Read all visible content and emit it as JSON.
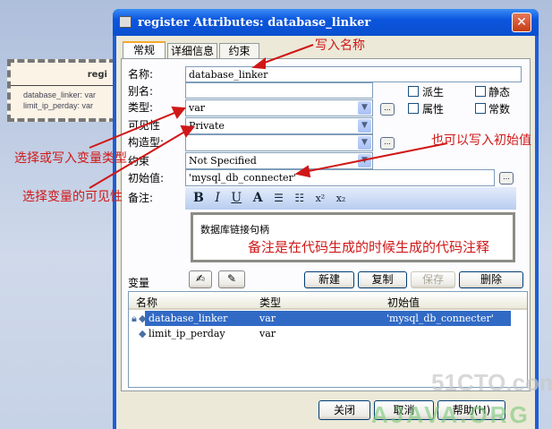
{
  "diagram": {
    "class_name": "regi",
    "attributes": [
      "database_linker: var",
      "limit_ip_perday: var"
    ],
    "markers": [
      "-",
      "+"
    ]
  },
  "window": {
    "title": "register Attributes: database_linker",
    "close": "✕"
  },
  "tabs": [
    {
      "label": "常规"
    },
    {
      "label": "详细信息"
    },
    {
      "label": "约束"
    }
  ],
  "form": {
    "name_label": "名称:",
    "name_value": "database_linker",
    "alias_label": "别名:",
    "alias_value": "",
    "type_label": "类型:",
    "type_value": "var",
    "visibility_label": "可见性",
    "visibility_value": "Private",
    "stereotype_label": "构造型:",
    "stereotype_value": "",
    "constraint_label": "约束",
    "constraint_value": "Not Specified",
    "initial_label": "初始值:",
    "initial_value": "'mysql_db_connecter'",
    "notes_label": "备注:",
    "notes_value": "数据库链接句柄",
    "ellipsis": "...",
    "checkboxes": [
      {
        "label": "派生",
        "checked": false
      },
      {
        "label": "静态",
        "checked": false
      },
      {
        "label": "属性",
        "checked": false
      },
      {
        "label": "常数",
        "checked": false
      }
    ],
    "toolbar": [
      "B",
      "I",
      "U",
      "A",
      "☰",
      "☷",
      "x²",
      "x₂"
    ]
  },
  "variables": {
    "label": "变量",
    "buttons": {
      "new": "新建",
      "copy": "复制",
      "save": "保存",
      "delete": "删除"
    },
    "columns": [
      "名称",
      "类型",
      "初始值"
    ],
    "rows": [
      {
        "name": "database_linker",
        "type": "var",
        "initial": "'mysql_db_connecter'",
        "selected": true
      },
      {
        "name": "limit_ip_perday",
        "type": "var",
        "initial": "",
        "selected": false
      }
    ]
  },
  "footer": {
    "close": "关闭",
    "cancel": "取消",
    "help": "帮助(H)"
  },
  "annotations": {
    "name": "写入名称",
    "initial": "也可以写入初始值",
    "type": "选择或写入变量类型",
    "visibility": "选择变量的可见性",
    "notes": "备注是在代码生成的时候生成的代码注释"
  },
  "watermarks": {
    "site1": "51CTO.com",
    "site2": "AJAVA.ORG"
  },
  "colors": {
    "title_bar": "#0b56de",
    "selection": "#316ac5",
    "annotation": "#d01818"
  }
}
